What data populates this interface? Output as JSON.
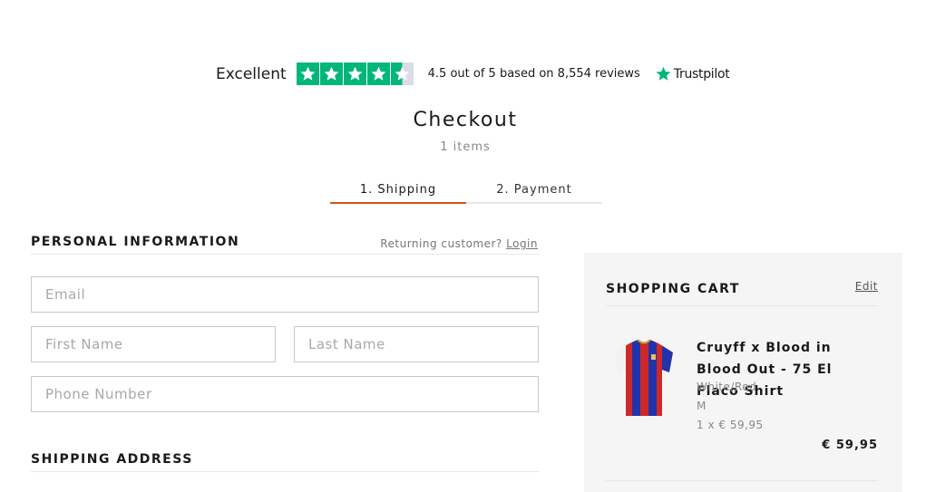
{
  "trustpilot": {
    "rating_word": "Excellent",
    "stars": 4.5,
    "star_color": "#00b67a",
    "summary_prefix": "4.5 out of 5 based on",
    "review_count": "8,554",
    "summary_suffix": "reviews",
    "brand": "Trustpilot",
    "brand_icon": "trustpilot-star-icon"
  },
  "page": {
    "title": "Checkout",
    "items_count": "1 items"
  },
  "steps": [
    {
      "label": "1. Shipping",
      "active": true
    },
    {
      "label": "2. Payment",
      "active": false
    }
  ],
  "accent_color": "#d4521f",
  "personal": {
    "title": "PERSONAL INFORMATION",
    "returning_text": "Returning customer?",
    "login_label": "Login",
    "fields": {
      "email_placeholder": "Email",
      "first_name_placeholder": "First Name",
      "last_name_placeholder": "Last Name",
      "phone_placeholder": "Phone Number"
    }
  },
  "shipping": {
    "title": "SHIPPING ADDRESS"
  },
  "cart": {
    "title": "SHOPPING CART",
    "edit_label": "Edit",
    "items": [
      {
        "name": "Cruyff x Blood in Blood Out - 75 El Flaco Shirt",
        "color": "White/Red",
        "size": "M",
        "qty_line": "1 x € 59,95",
        "total": "€ 59,95",
        "image_icon": "shirt-icon"
      }
    ]
  }
}
